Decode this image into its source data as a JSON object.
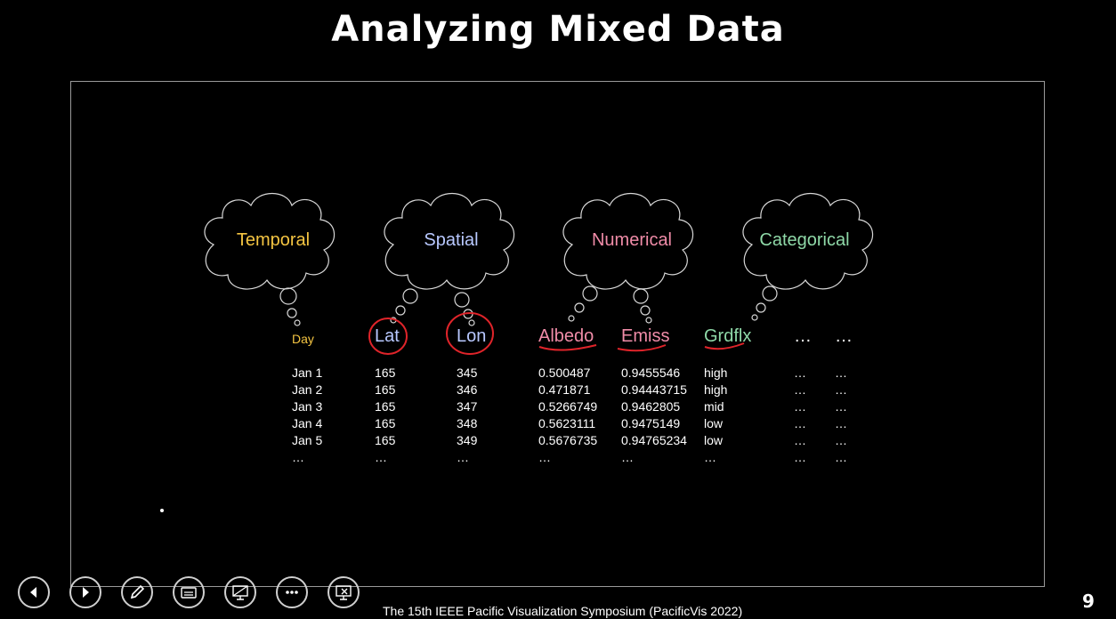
{
  "slide": {
    "title": "Analyzing Mixed Data",
    "footer": "The 15th IEEE Pacific Visualization Symposium (PacificVis 2022)",
    "page_number": "9"
  },
  "clouds": [
    {
      "label": "Temporal",
      "color": "#f5c542"
    },
    {
      "label": "Spatial",
      "color": "#b8c8ff"
    },
    {
      "label": "Numerical",
      "color": "#f08ca8"
    },
    {
      "label": "Categorical",
      "color": "#8fd9a8"
    }
  ],
  "table": {
    "headers": [
      "Day",
      "Lat",
      "Lon",
      "Albedo",
      "Emiss",
      "Grdflx",
      "…",
      "…"
    ],
    "header_colors": [
      "#f5c542",
      "#b8c8ff",
      "#b8c8ff",
      "#f08ca8",
      "#f08ca8",
      "#8fd9a8",
      "#ffffff",
      "#ffffff"
    ],
    "rows": [
      [
        "Jan 1",
        "165",
        "345",
        "0.500487",
        "0.9455546",
        "high",
        "…",
        "…"
      ],
      [
        "Jan 2",
        "165",
        "346",
        "0.471871",
        "0.94443715",
        "high",
        "…",
        "…"
      ],
      [
        "Jan 3",
        "165",
        "347",
        "0.5266749",
        "0.9462805",
        "mid",
        "…",
        "…"
      ],
      [
        "Jan 4",
        "165",
        "348",
        "0.5623111",
        "0.9475149",
        "low",
        "…",
        "…"
      ],
      [
        "Jan 5",
        "165",
        "349",
        "0.5676735",
        "0.94765234",
        "low",
        "…",
        "…"
      ],
      [
        "…",
        "…",
        "…",
        "…",
        "…",
        "…",
        "…",
        "…"
      ]
    ]
  },
  "annotation_color": "#e0242a",
  "controls": [
    {
      "icon": "previous-icon"
    },
    {
      "icon": "next-icon"
    },
    {
      "icon": "pen-icon"
    },
    {
      "icon": "subtitles-icon"
    },
    {
      "icon": "display-settings-icon"
    },
    {
      "icon": "more-options-icon"
    },
    {
      "icon": "end-show-icon"
    }
  ]
}
